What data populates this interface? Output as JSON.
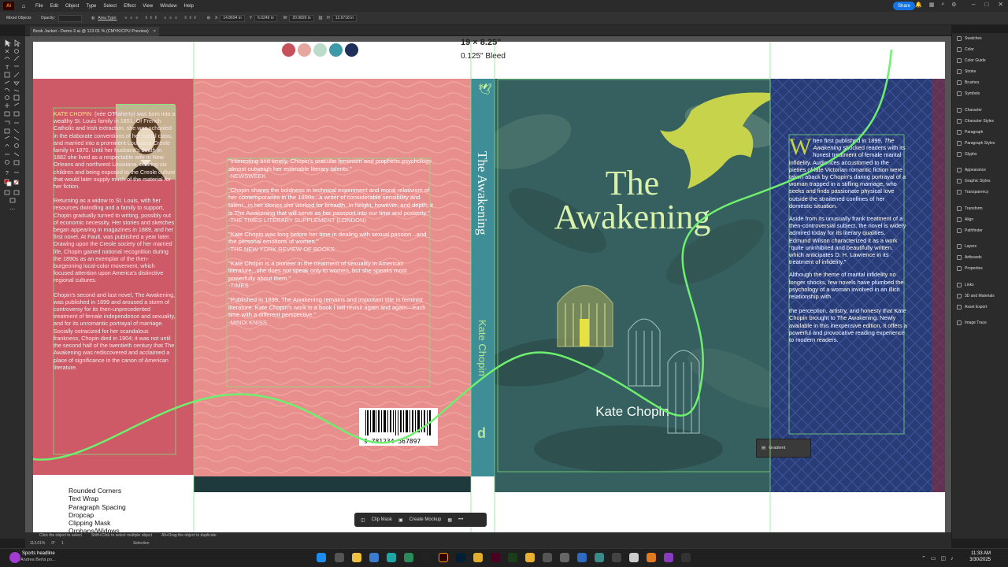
{
  "menubar": {
    "logo": "Ai",
    "items": [
      "File",
      "Edit",
      "Object",
      "Type",
      "Select",
      "Effect",
      "View",
      "Window",
      "Help"
    ],
    "share_label": "Share"
  },
  "controlbar": {
    "selection_label": "Mixed Objects",
    "opacity_label": "Opacity:",
    "area_type_label": "Area Type:",
    "x_value": "14.8694 in",
    "y_value": "6.6249 in",
    "w_label": "W",
    "w_value": "20.9826 in",
    "h_label": "H",
    "h_value": "12.6718 in"
  },
  "tab": {
    "title": "Book Jacket - Demo 2.ai @ 113.01 % (CMYK/CPU Preview)",
    "close": "×"
  },
  "right_panel": {
    "groups": [
      [
        "Swatches",
        "Color",
        "Color Guide",
        "Stroke",
        "Brushes",
        "Symbols"
      ],
      [
        "Character",
        "Character Styles",
        "Paragraph",
        "Paragraph Styles",
        "Glyphs"
      ],
      [
        "Appearance",
        "Graphic Styles",
        "Transparency"
      ],
      [
        "Transform",
        "Align",
        "Pathfinder"
      ],
      [
        "Layers",
        "Artboards",
        "Properties"
      ],
      [
        "Links",
        "3D and Materials",
        "Asset Export"
      ],
      [
        "Image Trace"
      ]
    ]
  },
  "swatches": {
    "colors": [
      "#c6505b",
      "#e6a7a1",
      "#bcdccb",
      "#3d9aa8",
      "#1f2f5a"
    ]
  },
  "dimensions": {
    "size": "19 × 8.25\"",
    "bleed": "0.125\" Bleed"
  },
  "back_flap": {
    "author_name": "KATE CHOPIN",
    "paragraph1": "(née O'Flaherty) was born into a wealthy St. Louis family in 1851. Of French Catholic and Irish extraction, she was schooled in the elaborate conventions of her social class, and married into a prominent Louisiana Creole family in 1870. Until her husband's death in 1882 she lived as a respectable wife in New Orleans and northwest Louisiana, bearing six children and being exposed to the Creole culture that would later supply much of the material for her fiction.",
    "paragraph2": "Returning as a widow to St. Louis, with her resources dwindling and a family to support, Chopin gradually turned to writing, possibly out of economic necessity. Her stories and sketches began appearing in magazines in 1889, and her first novel, At Fault, was published a year later. Drawing upon the Creole society of her married life, Chopin gained national recognition during the 1890s as an exemplar of the then-burgeoning local-color movement, which focused attention upon America's distinctive regional cultures.",
    "paragraph3": "Chopin's second and last novel, The Awakening, was published in 1899 and aroused a storm of controversy for its then-unprecedented treatment of female independence and sexuality, and for its unromantic portrayal of marriage. Socially ostracized for her scandalous frankness, Chopin died in 1904; it was not until the second half of the twentieth century that The Awakening was rediscovered and acclaimed a place of significance in the canon of American literature."
  },
  "back_cover": {
    "quotes": [
      {
        "text": "\"Interesting and timely, Chopin's oracular feminism and prophetic psychology almost outweigh her estimable literary talents.\"",
        "source": "-NEWSWEEK"
      },
      {
        "text": "\"Chopin shares the boldness in technical experiment and moral relativism of her contemporaries in the 1890s...a writer of considerable sensibility and talent...in her stories she worked for breadth. In height, however, and depth, it is The Awakening that will serve as her passport into our time and posterity.\"",
        "source": "-THE TIMES LITERARY SUPPLEMENT (LONDON)"
      },
      {
        "text": "\"Kate Chopin was long before her time in dealing with sexual passion...and the personal emotions of women.\"",
        "source": "-THE NEW YORK REVIEW OF BOOKS"
      },
      {
        "text": "\"Kate Chopin is a pioneer in the treatment of sexuality in American literature...she does not speak only to women, but she speaks most powerfully about them.\"",
        "source": "-TIMES"
      },
      {
        "text": "\"Published in 1899, The Awakening remains and important title in feminist literature. Kate Chopin's work is a book I will revisit again and again—each time with a different perspective.\"",
        "source": "-MINDI KNISS"
      }
    ],
    "barcode_number": "9 781234 567897"
  },
  "spine": {
    "title": "The Awakening",
    "author": "Kate Chopin",
    "logo": "d"
  },
  "front_cover": {
    "title_line1": "The",
    "title_line2": "Awakening",
    "author": "Kate Chopin"
  },
  "front_flap": {
    "drop_cap": "W",
    "p1_start": "hen first published in 1899, ",
    "p1_italic": "The Awakening",
    "p1_rest": " shocked readers with its honest treatment of female marital infidelity. Audiences accustomed to the pieties of late Victorian romantic fiction were taken aback by Chopin's daring portrayal of a woman trapped in a stifling marriage, who seeks and finds passionate physical love outside the straitened confines of her domestic situation.",
    "p2": "Aside from its unusually frank treatment of a then-controversial subject, the novel is widely admired today for its literary qualities. Edmund Wilson characterized it as a work \"quite uninhibited and beautifully written, which anticipates D. H. Lawrence in its treatment of infidelity.\"",
    "p3": "Although the theme of marital infidelity no longer shocks, few novels have plumbed the psychology of a woman involved in an illicit relationship with",
    "p4": "the perception, artistry, and honesty that Kate Chopin brought to The Awakening. Newly available in this inexpensive edition, it offers a powerful and provocative reading experience to modern readers."
  },
  "gradient_panel": {
    "label": "Gradient"
  },
  "features_list": [
    "Rounded Corners",
    "Text Wrap",
    "Paragraph Spacing",
    "Dropcap",
    "Clipping Mask",
    "Orphans/Widows"
  ],
  "context_toolbar": {
    "clip_mask": "Clip Mask",
    "create_mockup": "Create Mockup",
    "more": "•••"
  },
  "status": {
    "zoom": "113.01%",
    "angle": "0°",
    "artboard_num": "1",
    "hint1": "Click the object to select",
    "hint2": "Shift+Click to select multiple object",
    "hint3": "Alt+Drag the object to duplicate",
    "selection": "Selection"
  },
  "taskbar": {
    "news_title": "Sports headline",
    "news_sub": "Andrea Berta po...",
    "time": "11:33 AM",
    "date": "3/30/2025"
  }
}
